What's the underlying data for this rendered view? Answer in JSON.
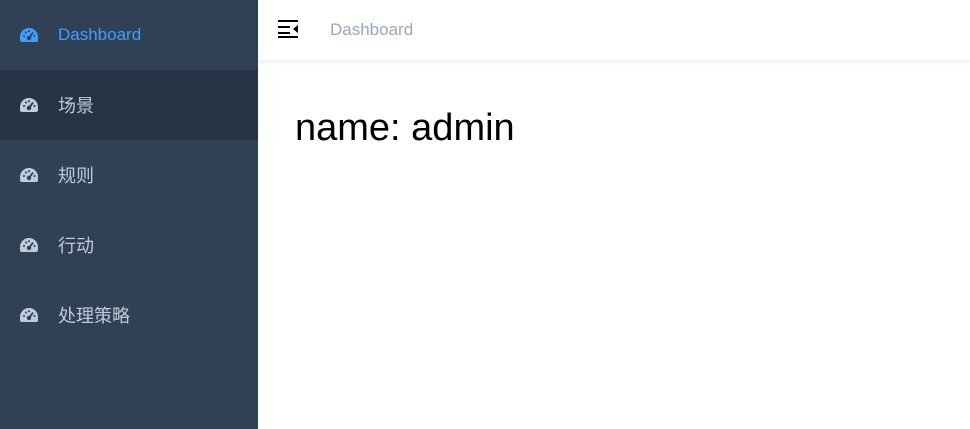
{
  "sidebar": {
    "items": [
      {
        "label": "Dashboard",
        "icon": "dashboard-icon"
      },
      {
        "label": "场景",
        "icon": "dashboard-icon"
      },
      {
        "label": "规则",
        "icon": "dashboard-icon"
      },
      {
        "label": "行动",
        "icon": "dashboard-icon"
      },
      {
        "label": "处理策略",
        "icon": "dashboard-icon"
      }
    ]
  },
  "header": {
    "toggle_icon": "hamburger-icon",
    "breadcrumb": "Dashboard"
  },
  "main": {
    "name_text": "name: admin"
  },
  "colors": {
    "sidebar_bg": "#304156",
    "sidebar_hover_bg": "#263445",
    "sidebar_text": "#bfcbd9",
    "active_text": "#409eff",
    "breadcrumb_text": "#97a8be"
  }
}
